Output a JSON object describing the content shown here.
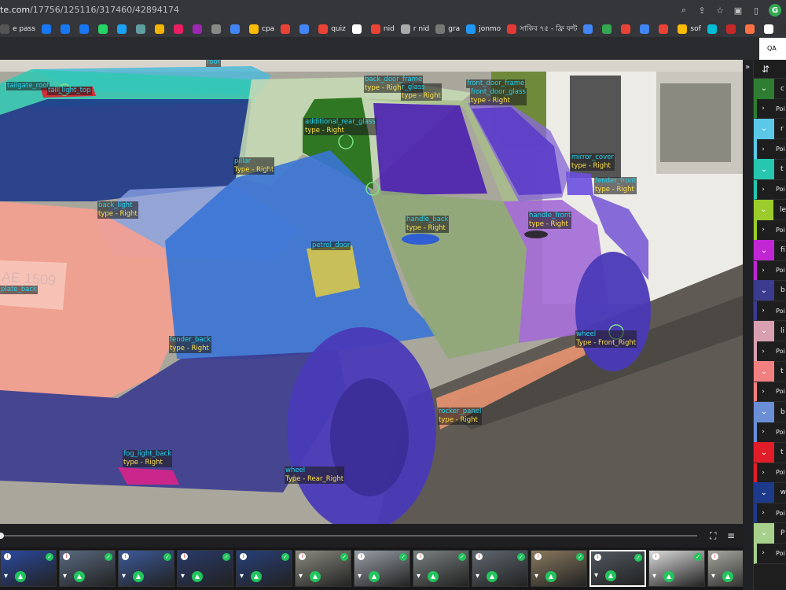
{
  "browser": {
    "url_domain": "te.com",
    "url_path": "/17756/125116/317460/42894174",
    "profile_initial": "G"
  },
  "bookmarks": [
    {
      "label": "e pass",
      "color": "#555555"
    },
    {
      "label": "",
      "color": "#1877f2"
    },
    {
      "label": "",
      "color": "#1877f2"
    },
    {
      "label": "",
      "color": "#1877f2"
    },
    {
      "label": "",
      "color": "#25d366"
    },
    {
      "label": "",
      "color": "#1da1f2"
    },
    {
      "label": "",
      "color": "#5f9ea0"
    },
    {
      "label": "",
      "color": "#f4b400"
    },
    {
      "label": "",
      "color": "#e91e63"
    },
    {
      "label": "",
      "color": "#9c27b0"
    },
    {
      "label": "",
      "color": "#888888"
    },
    {
      "label": "",
      "color": "#4285f4"
    },
    {
      "label": "cpa",
      "color": "#fbbc04"
    },
    {
      "label": "",
      "color": "#ea4335"
    },
    {
      "label": "",
      "color": "#4285f4"
    },
    {
      "label": "quiz",
      "color": "#ea4335"
    },
    {
      "label": "",
      "color": "#ffffff"
    },
    {
      "label": "nid",
      "color": "#ea4335"
    },
    {
      "label": "r nid",
      "color": "#aaaaaa"
    },
    {
      "label": "gra",
      "color": "#777777"
    },
    {
      "label": "jonmo",
      "color": "#2196f3"
    },
    {
      "label": "সাকিব ৭৫ - ফ্রি ফন্ট",
      "color": "#e53935"
    },
    {
      "label": "",
      "color": "#4285f4"
    },
    {
      "label": "",
      "color": "#34a853"
    },
    {
      "label": "",
      "color": "#ea4335"
    },
    {
      "label": "",
      "color": "#4285f4"
    },
    {
      "label": "",
      "color": "#ea4335"
    },
    {
      "label": "sof",
      "color": "#fbbc04"
    },
    {
      "label": "",
      "color": "#00bcd4"
    },
    {
      "label": "",
      "color": "#c62828"
    },
    {
      "label": "",
      "color": "#ff7043"
    },
    {
      "label": "",
      "color": "#ffffff"
    },
    {
      "label": "",
      "color": "#333333"
    }
  ],
  "strip_right_label": "QA mo",
  "annotations": [
    {
      "name": "roof",
      "type": ""
    },
    {
      "name": "tailgate_roof",
      "type": ""
    },
    {
      "name": "tail_light_top",
      "type": ""
    },
    {
      "name": "back_door_frame",
      "type": "type - Right"
    },
    {
      "name": "r_glass",
      "type": "type - Right"
    },
    {
      "name": "front_door_frame",
      "type": ""
    },
    {
      "name": "front_door_glass",
      "type": "type - Right"
    },
    {
      "name": "additional_rear_glass",
      "type": "type - Right"
    },
    {
      "name": "pillar",
      "type": "Type - Right"
    },
    {
      "name": "mirror_cover",
      "type": "type - Right"
    },
    {
      "name": "fender_front",
      "type": "type - Right"
    },
    {
      "name": "back_light",
      "type": "type - Right"
    },
    {
      "name": "handle_back",
      "type": "type - Right"
    },
    {
      "name": "handle_front",
      "type": "type - Right"
    },
    {
      "name": "petrol_door",
      "type": ""
    },
    {
      "name": "plate_back",
      "type": ""
    },
    {
      "name": "wheel",
      "type": "Type - Front_Right"
    },
    {
      "name": "fender_back",
      "type": "type - Right"
    },
    {
      "name": "rocker_panel",
      "type": "type - Right"
    },
    {
      "name": "fog_light_back",
      "type": "type - Right"
    },
    {
      "name": "wheel",
      "type": "Type - Rear_Right"
    }
  ],
  "plate_text": "AE 1509",
  "thumbnails": [
    {
      "selected": false
    },
    {
      "selected": false
    },
    {
      "selected": false
    },
    {
      "selected": false
    },
    {
      "selected": false
    },
    {
      "selected": false
    },
    {
      "selected": false
    },
    {
      "selected": false
    },
    {
      "selected": false
    },
    {
      "selected": false
    },
    {
      "selected": true
    },
    {
      "selected": false
    },
    {
      "selected": false
    }
  ],
  "panel": {
    "groups": [
      {
        "initial": "c",
        "color": "#2e7d32"
      },
      {
        "initial": "r",
        "color": "#5bc8e8"
      },
      {
        "initial": "t",
        "color": "#26c6b0"
      },
      {
        "initial": "le",
        "color": "#9ccc2b"
      },
      {
        "initial": "fi",
        "color": "#c026d3"
      },
      {
        "initial": "b",
        "color": "#3b3b8f"
      },
      {
        "initial": "li",
        "color": "#d8a0b0"
      },
      {
        "initial": "t",
        "color": "#f28080"
      },
      {
        "initial": "b",
        "color": "#6a8fd6"
      },
      {
        "initial": "t",
        "color": "#e11d2a"
      },
      {
        "initial": "w",
        "color": "#1e3a8a"
      },
      {
        "initial": "P",
        "color": "#a8d08d"
      }
    ],
    "sub_label": "Poi"
  }
}
